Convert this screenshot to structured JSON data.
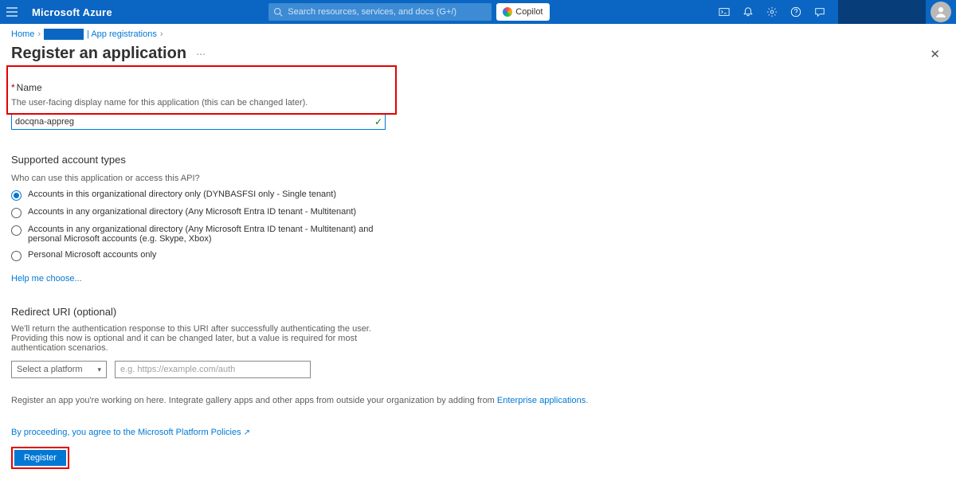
{
  "topbar": {
    "brand": "Microsoft Azure",
    "search_placeholder": "Search resources, services, and docs (G+/)",
    "copilot_label": "Copilot"
  },
  "breadcrumb": {
    "home": "Home",
    "app_reg": "| App registrations"
  },
  "page": {
    "title": "Register an application"
  },
  "name_section": {
    "label": "Name",
    "help": "The user-facing display name for this application (this can be changed later).",
    "value": "docqna-appreg"
  },
  "account_types": {
    "heading": "Supported account types",
    "subheading": "Who can use this application or access this API?",
    "opt1": "Accounts in this organizational directory only (DYNBASFSI only - Single tenant)",
    "opt2": "Accounts in any organizational directory (Any Microsoft Entra ID tenant - Multitenant)",
    "opt3": "Accounts in any organizational directory (Any Microsoft Entra ID tenant - Multitenant) and personal Microsoft accounts (e.g. Skype, Xbox)",
    "opt4": "Personal Microsoft accounts only",
    "help_link": "Help me choose..."
  },
  "redirect": {
    "heading": "Redirect URI (optional)",
    "desc": "We'll return the authentication response to this URI after successfully authenticating the user. Providing this now is optional and it can be changed later, but a value is required for most authentication scenarios.",
    "platform_placeholder": "Select a platform",
    "uri_placeholder": "e.g. https://example.com/auth"
  },
  "footer": {
    "text_before": "Register an app you're working on here. Integrate gallery apps and other apps from outside your organization by adding from ",
    "link": "Enterprise applications",
    "policy": "By proceeding, you agree to the Microsoft Platform Policies",
    "register_label": "Register"
  }
}
